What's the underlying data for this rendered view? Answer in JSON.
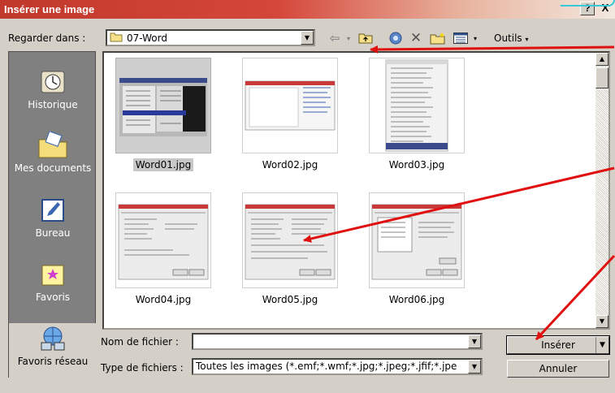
{
  "window": {
    "title": "Insérer une image",
    "help_label": "?",
    "close_label": "X"
  },
  "toolbar": {
    "lookin_label": "Regarder dans :",
    "lookin_value": "07-Word",
    "tools_label": "Outils",
    "icons": [
      "back-icon",
      "up-folder-icon",
      "search-web-icon",
      "delete-icon",
      "new-folder-icon",
      "views-icon"
    ]
  },
  "places": [
    {
      "label": "Historique",
      "icon": "history-icon"
    },
    {
      "label": "Mes documents",
      "icon": "my-documents-icon"
    },
    {
      "label": "Bureau",
      "icon": "desktop-icon"
    },
    {
      "label": "Favoris",
      "icon": "favorites-icon"
    },
    {
      "label": "Favoris réseau",
      "icon": "network-favorites-icon"
    }
  ],
  "files": [
    {
      "name": "Word01.jpg",
      "selected": true
    },
    {
      "name": "Word02.jpg",
      "selected": false
    },
    {
      "name": "Word03.jpg",
      "selected": false
    },
    {
      "name": "Word04.jpg",
      "selected": false
    },
    {
      "name": "Word05.jpg",
      "selected": false
    },
    {
      "name": "Word06.jpg",
      "selected": false
    }
  ],
  "form": {
    "filename_label": "Nom de fichier :",
    "filename_value": "",
    "filetype_label": "Type de fichiers :",
    "filetype_value": "Toutes les images (*.emf;*.wmf;*.jpg;*.jpeg;*.jfif;*.jpe"
  },
  "buttons": {
    "insert": "Insérer",
    "cancel": "Annuler"
  },
  "colors": {
    "title_bar": "#c0392b",
    "annotation_arrow": "#e01010",
    "dialog_bg": "#d4d0c8",
    "places_bg": "#808080"
  }
}
